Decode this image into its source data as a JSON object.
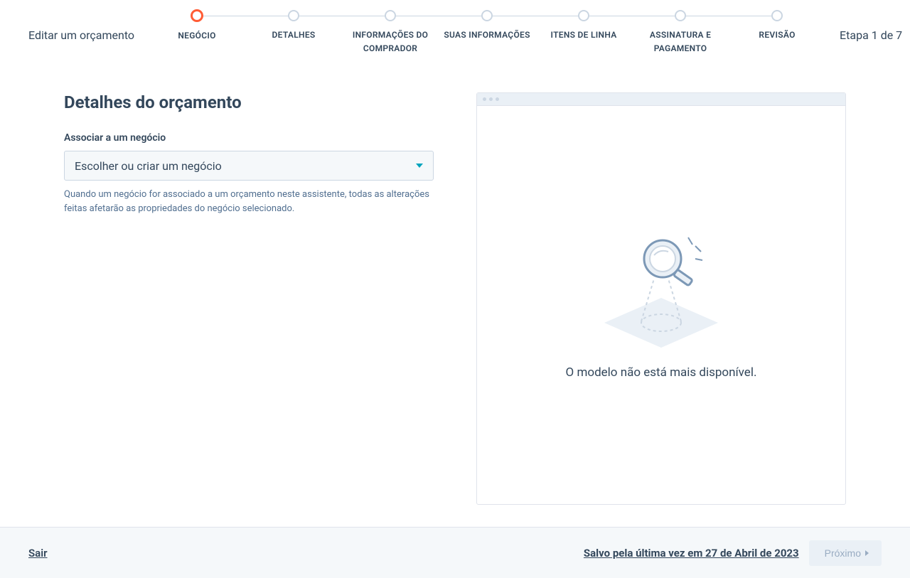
{
  "header": {
    "title": "Editar um orçamento",
    "step_counter": "Etapa 1 de 7"
  },
  "steps": [
    {
      "label": "NEGÓCIO",
      "active": true
    },
    {
      "label": "DETALHES",
      "active": false
    },
    {
      "label": "INFORMAÇÕES DO COMPRADOR",
      "active": false
    },
    {
      "label": "SUAS INFORMAÇÕES",
      "active": false
    },
    {
      "label": "ITENS DE LINHA",
      "active": false
    },
    {
      "label": "ASSINATURA E PAGAMENTO",
      "active": false
    },
    {
      "label": "REVISÃO",
      "active": false
    }
  ],
  "main": {
    "section_title": "Detalhes do orçamento",
    "field_label": "Associar a um negócio",
    "select_placeholder": "Escolher ou criar um negócio",
    "help_text": "Quando um negócio for associado a um orçamento neste assistente, todas as alterações feitas afetarão as propriedades do negócio selecionado."
  },
  "preview": {
    "empty_message": "O modelo não está mais disponível."
  },
  "footer": {
    "exit_label": "Sair",
    "saved_label": "Salvo pela última vez em 27 de Abril de 2023",
    "next_label": "Próximo"
  }
}
